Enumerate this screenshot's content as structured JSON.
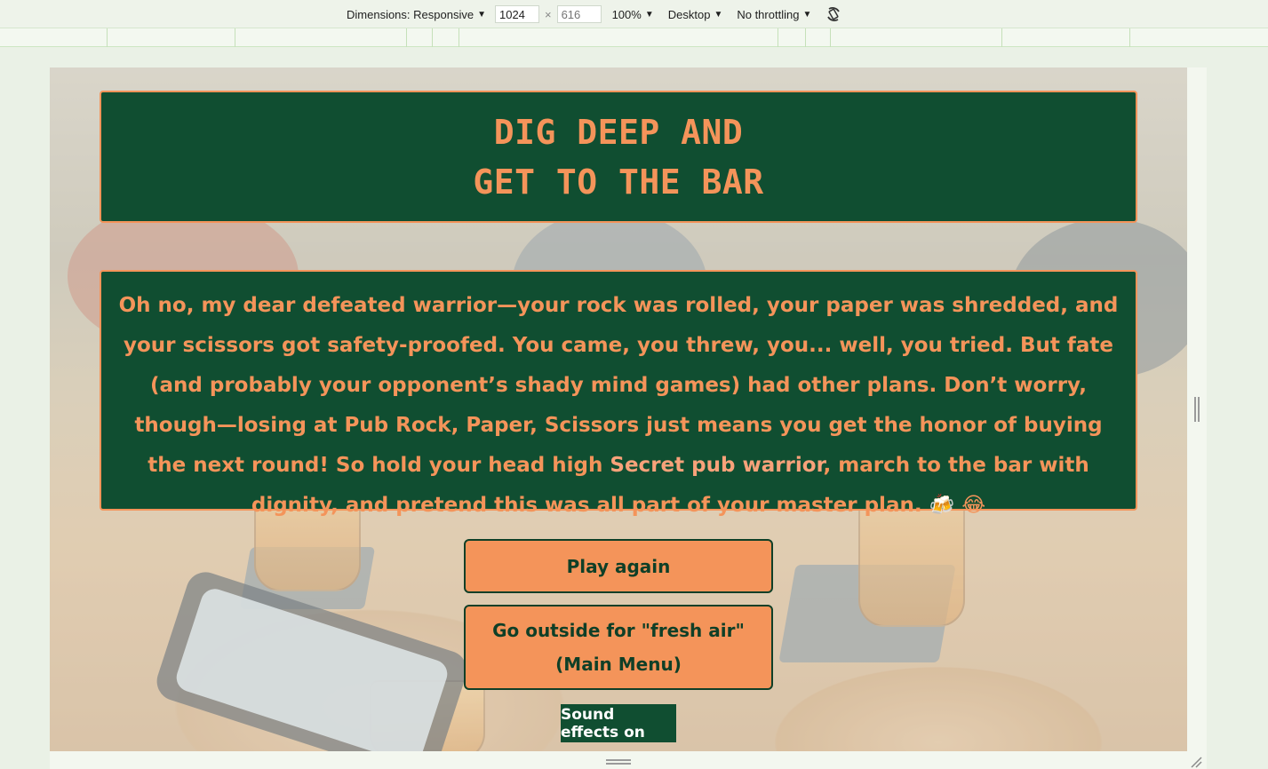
{
  "devtools": {
    "dimensions_label": "Dimensions: Responsive",
    "width_value": "1024",
    "height_placeholder": "616",
    "zoom_label": "100%",
    "device_label": "Desktop",
    "throttling_label": "No throttling"
  },
  "page": {
    "title_line1": "DIG DEEP AND",
    "title_line2": "GET TO THE BAR",
    "message_before": "Oh no, my dear defeated warrior—your rock was rolled, your paper was shredded, and your scissors got safety-proofed. You came, you threw, you... well, you tried. But fate (and probably your opponent’s shady mind games) had other plans. Don’t worry, though—losing at Pub Rock, Paper, Scissors just means you get the honor of buying the next round! So hold your head high ",
    "player_name": "Secret pub warrior",
    "message_after": ", march to the bar with dignity, and pretend this was all part of your master plan. 🍻 😂",
    "play_again_label": "Play again",
    "main_menu_label": "Go outside for \"fresh air\" (Main Menu)",
    "sound_label": "Sound effects on"
  },
  "colors": {
    "panel_bg": "#104e31",
    "accent_orange": "#f4945a",
    "button_text": "#0f3f27"
  }
}
